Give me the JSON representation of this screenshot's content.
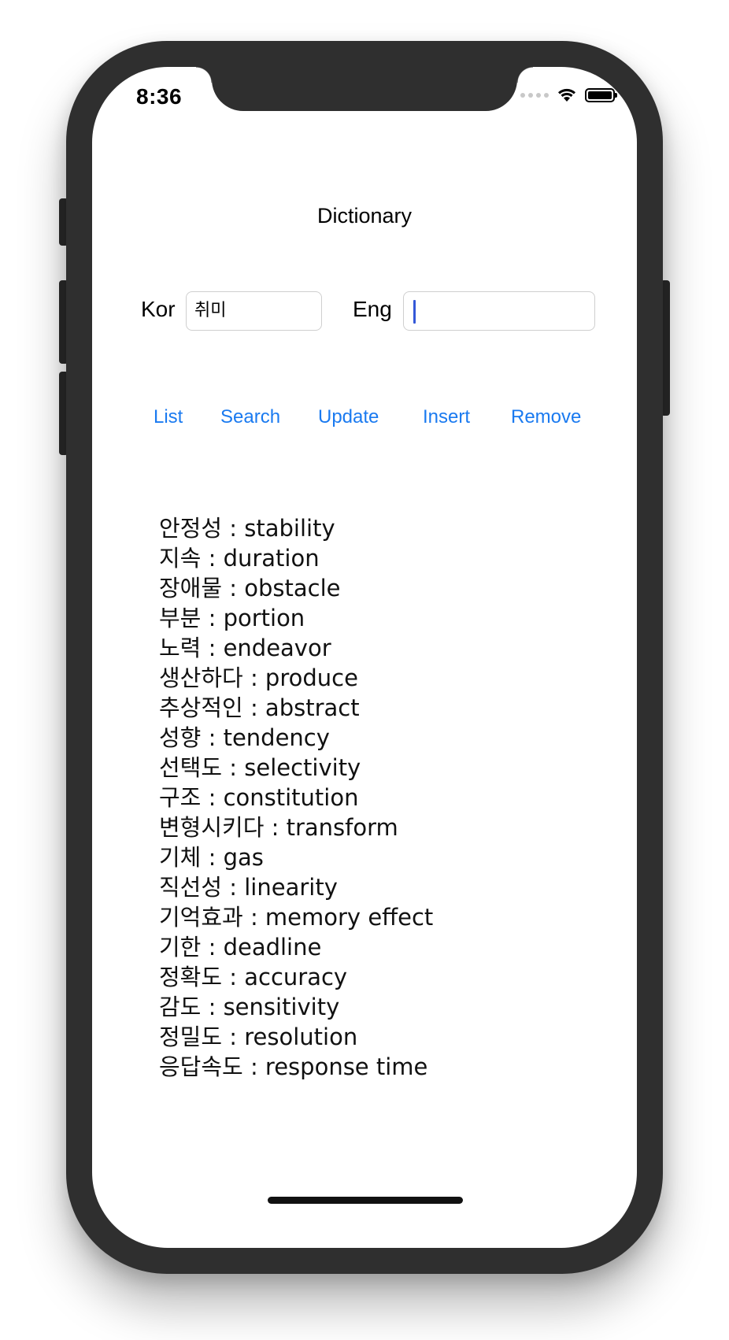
{
  "status_bar": {
    "time": "8:36"
  },
  "app": {
    "title": "Dictionary"
  },
  "form": {
    "kor_label": "Kor",
    "kor_value": "취미",
    "eng_label": "Eng",
    "eng_value": ""
  },
  "actions": {
    "list": "List",
    "search": "Search",
    "update": "Update",
    "insert": "Insert",
    "remove": "Remove"
  },
  "words": [
    "안정성 : stability",
    "지속 : duration",
    "장애물 : obstacle",
    "부분 : portion",
    "노력 : endeavor",
    "생산하다 : produce",
    "추상적인 : abstract",
    "성향 : tendency",
    "선택도 : selectivity",
    "구조 : constitution",
    "변형시키다 : transform",
    "기체 : gas",
    "직선성 : linearity",
    "기억효과 : memory effect",
    "기한 : deadline",
    "정확도 : accuracy",
    "감도 : sensitivity",
    "정밀도 : resolution",
    "응답속도 : response time"
  ],
  "colors": {
    "action_tint": "#1a7af0",
    "caret": "#3458d8",
    "device_frame": "#2f2f2f"
  }
}
